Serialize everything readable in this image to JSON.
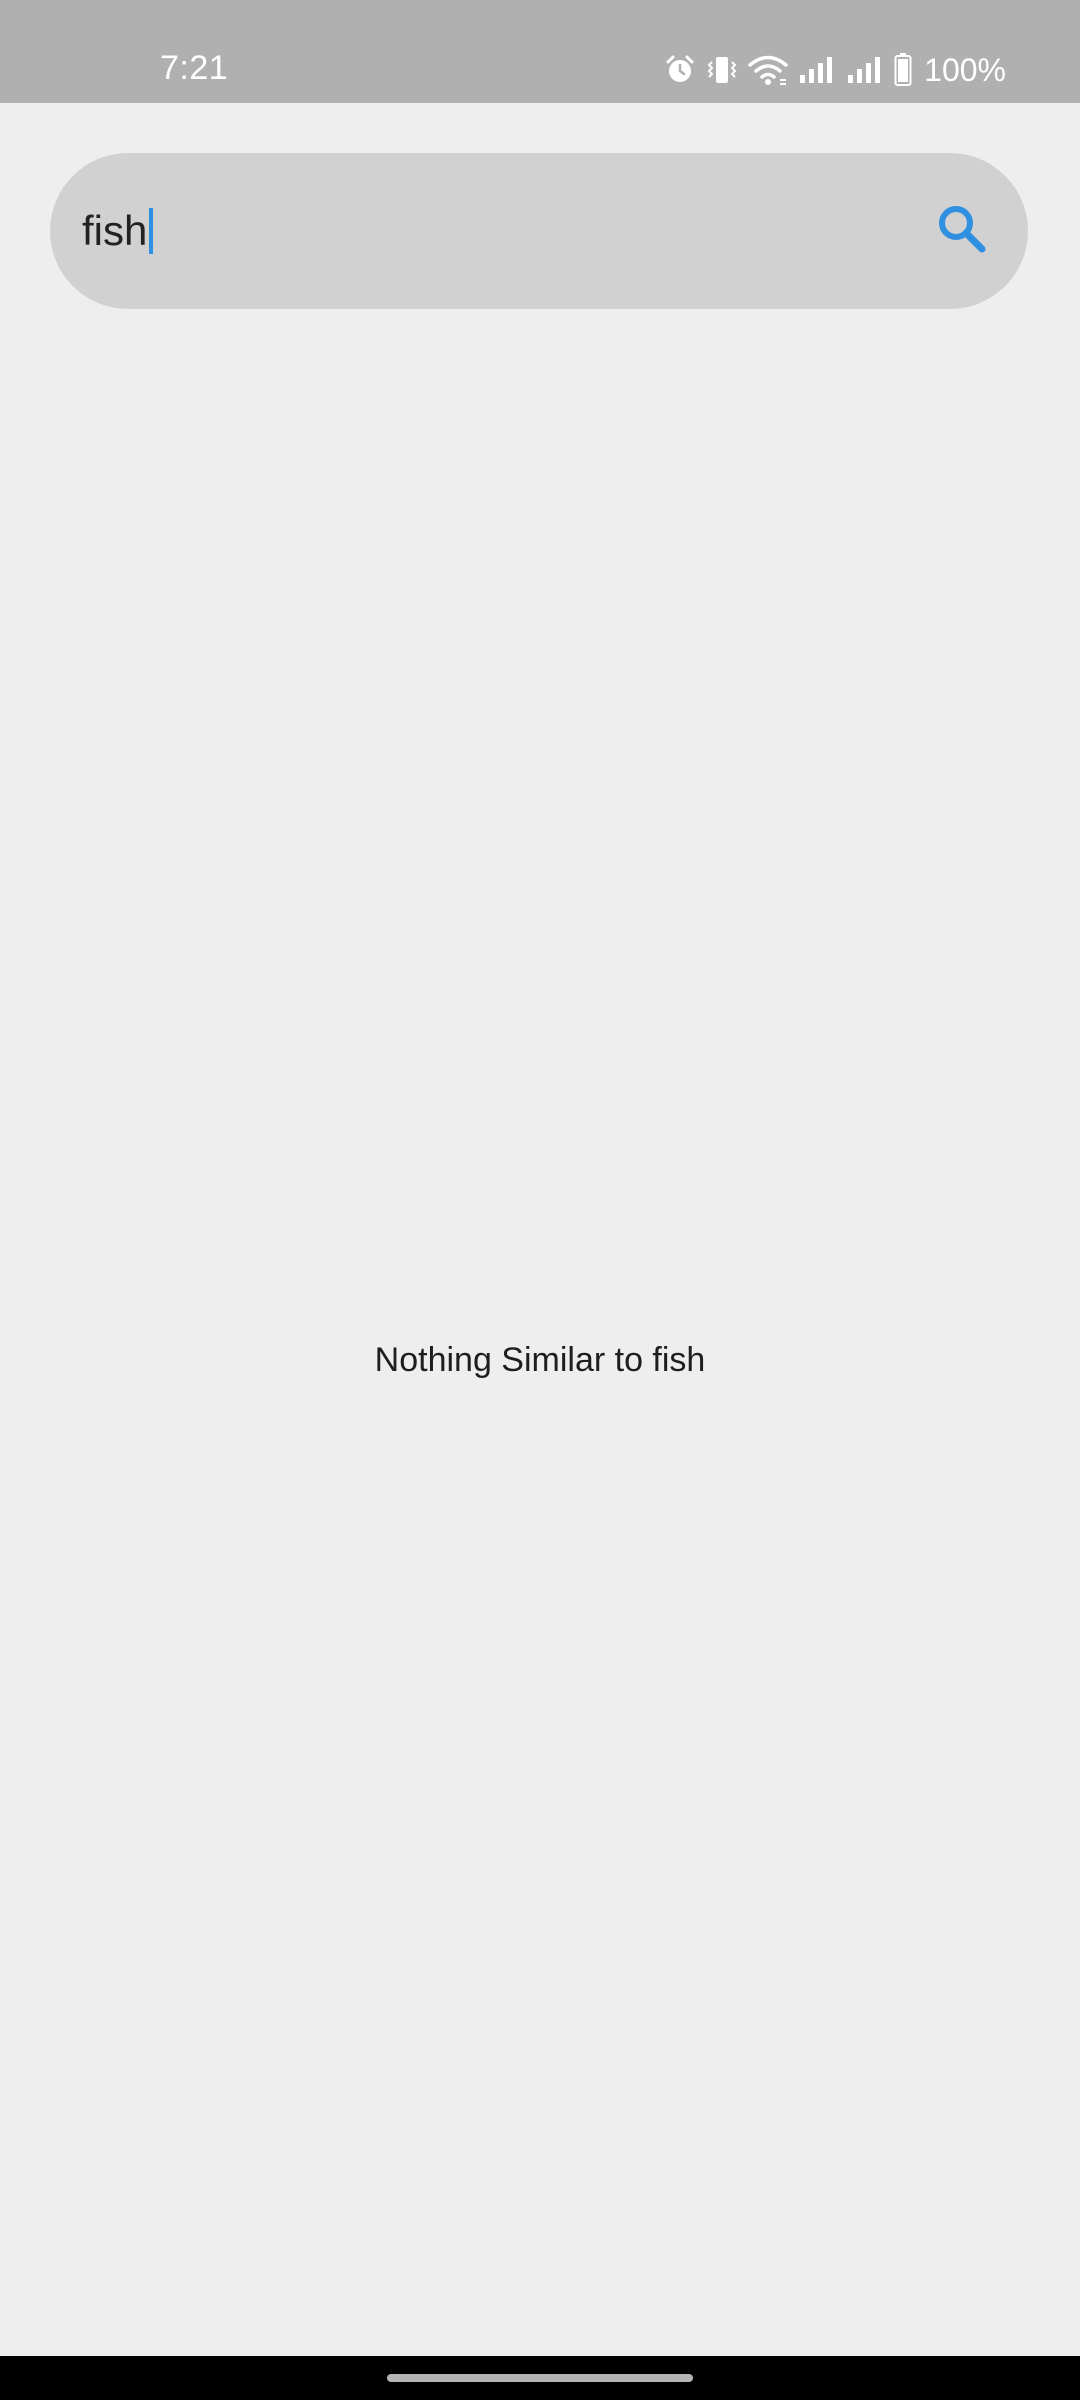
{
  "status_bar": {
    "time": "7:21",
    "battery_percent": "100%",
    "icons": [
      "alarm-icon",
      "vibrate-icon",
      "wifi-icon",
      "signal-icon",
      "signal-icon",
      "battery-icon"
    ]
  },
  "search": {
    "value": "fish",
    "icon": "search-icon",
    "accent_color": "#2f8fe0"
  },
  "results": {
    "empty_message": "Nothing Similar to fish"
  },
  "colors": {
    "status_bar_bg": "#b0b0b0",
    "page_bg": "#eeeeee",
    "search_bg": "#d1d1d1"
  }
}
